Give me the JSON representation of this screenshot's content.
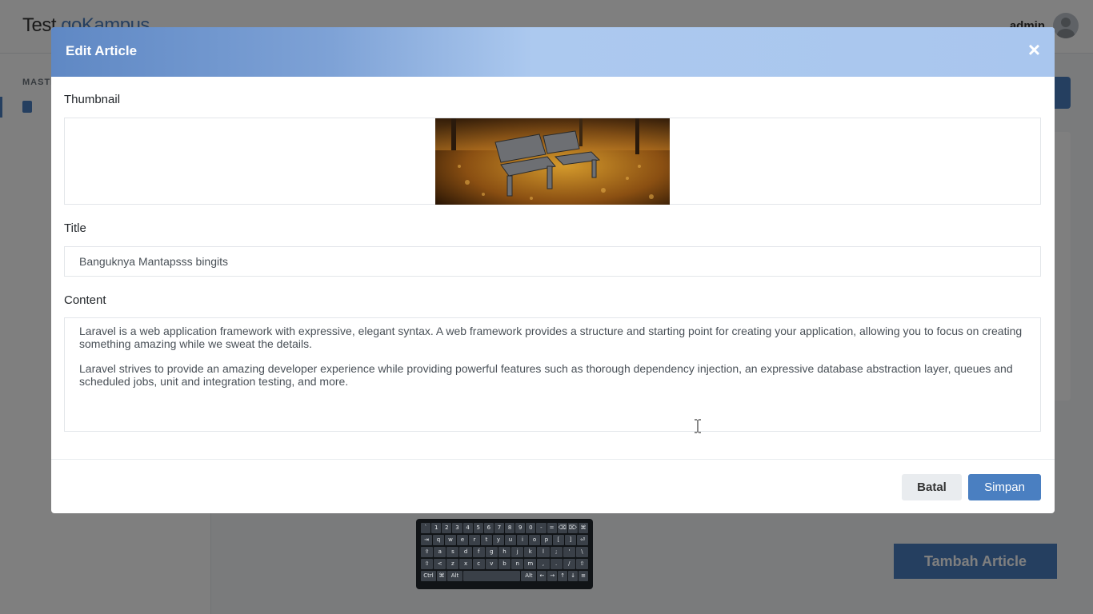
{
  "app": {
    "brand_part1": "Test ",
    "brand_part2": "goKampus",
    "user_name": "admin",
    "sidebar_section": "MASTER",
    "add_button": "Tambah Article"
  },
  "modal": {
    "title": "Edit Article",
    "close_symbol": "×",
    "thumbnail_label": "Thumbnail",
    "title_label": "Title",
    "title_value": "Banguknya Mantapsss bingits",
    "content_label": "Content",
    "content_paragraphs": [
      "Laravel is a web application framework with expressive, elegant syntax. A web framework provides a structure and starting point for creating your application, allowing you to focus on creating something amazing while we sweat the details.",
      "Laravel strives to provide an amazing developer experience while providing powerful features such as thorough dependency injection, an expressive database abstraction layer, queues and scheduled jobs, unit and integration testing, and more."
    ],
    "cancel_button": "Batal",
    "save_button": "Simpan"
  },
  "keyboard": {
    "rows": [
      [
        "`",
        "1",
        "2",
        "3",
        "4",
        "5",
        "6",
        "7",
        "8",
        "9",
        "0",
        "-",
        "=",
        "⌫",
        "⌦",
        "⌘"
      ],
      [
        "⇥",
        "q",
        "w",
        "e",
        "r",
        "t",
        "y",
        "u",
        "i",
        "o",
        "p",
        "[",
        "]",
        "⏎"
      ],
      [
        "⇪",
        "a",
        "s",
        "d",
        "f",
        "g",
        "h",
        "j",
        "k",
        "l",
        ";",
        "'",
        "\\"
      ],
      [
        "⇧",
        "<",
        "z",
        "x",
        "c",
        "v",
        "b",
        "n",
        "m",
        ",",
        ".",
        "/",
        "⇧"
      ],
      [
        "Ctrl",
        "⌘",
        "Alt",
        " ",
        "Alt Gr",
        "←",
        "→",
        "↑",
        "↓",
        "≡"
      ]
    ]
  },
  "colors": {
    "accent": "#4a7fc1",
    "header_gradient_start": "#5f88c4",
    "header_gradient_end": "#a9c6ee"
  },
  "icons": {
    "close": "close-icon",
    "avatar": "user-avatar-icon",
    "sidebar_item": "book-icon",
    "cursor": "text-cursor-icon"
  }
}
